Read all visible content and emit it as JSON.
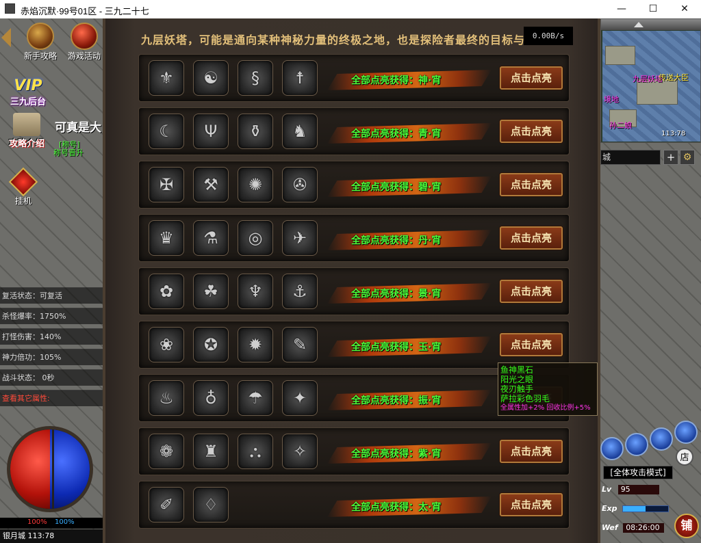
{
  "window": {
    "title": "赤焰沉默·99号01区 - 三九二十七",
    "minimize": "—",
    "maximize": "☐",
    "close": "✕"
  },
  "left_hud": {
    "buttons": [
      {
        "label": "新手攻略",
        "icon": "scroll-icon"
      },
      {
        "label": "游戏活动",
        "icon": "event-icon"
      }
    ],
    "vip_label": "VIP",
    "vip_sub": "三九后台",
    "guide_label": "攻略介绍",
    "npc_name": "可真是大",
    "npc_tag": "[称号]",
    "npc_sub": "称号晋升",
    "afk_label": "挂机",
    "stats": [
      "复活状态：可复活",
      "杀怪爆率：1750%",
      "打怪伤害：140%",
      "神力倍功：105%",
      "战斗状态： 0秒",
      "查看其它属性:"
    ],
    "hp_pct": "100%",
    "mp_pct": "100%",
    "location": "银月城 113:78"
  },
  "panel": {
    "header": "九层妖塔，可能是通向某种神秘力量的终极之地，也是探险者最终的目标与",
    "speed": "0.00B/s",
    "rows": [
      {
        "icons": [
          "⚜",
          "☯",
          "§",
          "☨"
        ],
        "reward": "全部点亮获得：神·宵",
        "button": "点击点亮"
      },
      {
        "icons": [
          "☾",
          "Ψ",
          "⚱",
          "♞"
        ],
        "reward": "全部点亮获得：青·宵",
        "button": "点击点亮"
      },
      {
        "icons": [
          "✠",
          "⚒",
          "✺",
          "✇"
        ],
        "reward": "全部点亮获得：碧·宵",
        "button": "点击点亮"
      },
      {
        "icons": [
          "♛",
          "⚗",
          "◎",
          "✈"
        ],
        "reward": "全部点亮获得：丹·宵",
        "button": "点击点亮"
      },
      {
        "icons": [
          "✿",
          "☘",
          "♆",
          "⚓"
        ],
        "reward": "全部点亮获得：景·宵",
        "button": "点击点亮"
      },
      {
        "icons": [
          "❀",
          "✪",
          "✹",
          "✎"
        ],
        "reward": "全部点亮获得：玉·宵",
        "button": "点击点亮"
      },
      {
        "icons": [
          "♨",
          "♁",
          "☂",
          "✦"
        ],
        "reward": "全部点亮获得：振·宵",
        "button": "点击点亮"
      },
      {
        "icons": [
          "❁",
          "♜",
          "⛬",
          "✧"
        ],
        "reward": "全部点亮获得：紫·宵",
        "button": "点击点亮"
      },
      {
        "icons": [
          "✐",
          "♢"
        ],
        "reward": "全部点亮获得：太·宵",
        "button": "点击点亮"
      }
    ]
  },
  "tooltip": {
    "lines": [
      "鱼神黑石",
      "阳光之眼",
      "夜刃触手",
      "萨拉彩色羽毛"
    ],
    "bonus": "全属性加+2% 回收比例+5%"
  },
  "right_hud": {
    "map_coords": "113:78",
    "map_labels": [
      "九层妖塔",
      "境地",
      "孙二娘",
      "传送大臣"
    ],
    "city_input": "城",
    "attack_mode": "[全体攻击模式]",
    "lv_label": "Lv",
    "lv_value": "95",
    "exp_label": "Exp",
    "wef_label": "Wef",
    "time": "08:26:00",
    "shop_label": "铺",
    "store_label": "店"
  }
}
